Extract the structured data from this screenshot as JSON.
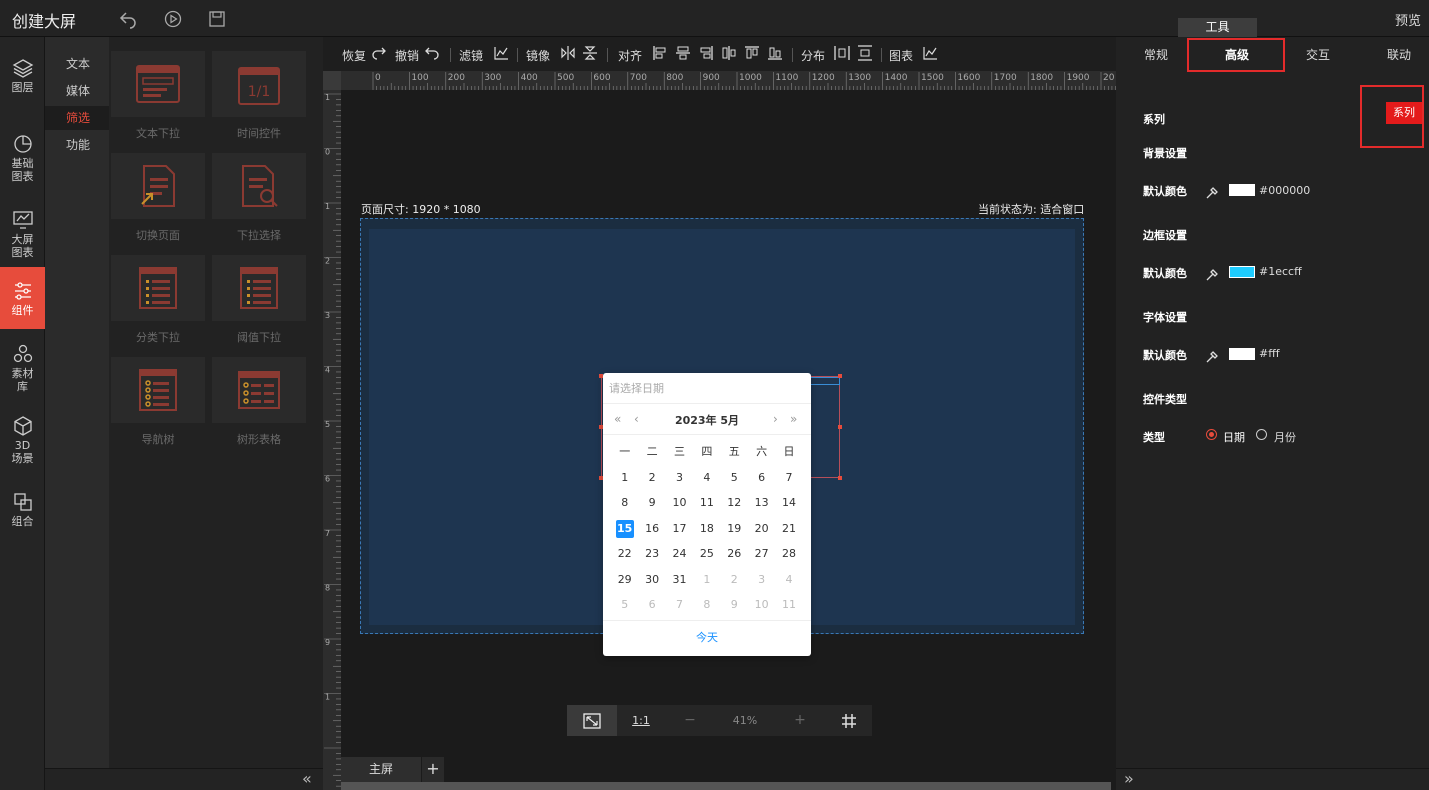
{
  "app": {
    "title": "创建大屏",
    "preview": "预览",
    "tooltip": "工具"
  },
  "leftnav": [
    {
      "label": "图层"
    },
    {
      "label": "基础\n图表"
    },
    {
      "label": "大屏\n图表"
    },
    {
      "label": "组件"
    },
    {
      "label": "素材\n库"
    },
    {
      "label": "3D\n场景"
    },
    {
      "label": "组合"
    }
  ],
  "subnav": [
    "文本",
    "媒体",
    "筛选",
    "功能"
  ],
  "widgets": [
    "文本下拉",
    "时间控件",
    "切换页面",
    "下拉选择",
    "分类下拉",
    "阈值下拉",
    "导航树",
    "树形表格"
  ],
  "toolbar": {
    "redo": "恢复",
    "undo": "撤销",
    "filter": "滤镜",
    "mirror": "镜像",
    "align": "对齐",
    "distribute": "分布",
    "chart": "图表"
  },
  "ruler": [
    "0",
    "100",
    "200",
    "300",
    "400",
    "500",
    "600",
    "700",
    "800",
    "900",
    "1000",
    "1100",
    "1200",
    "1300",
    "1400",
    "1500",
    "1600",
    "1700",
    "1800",
    "1900",
    "20"
  ],
  "ruler_v": [
    "1",
    "0",
    "1",
    "2",
    "3",
    "4",
    "5",
    "6",
    "7",
    "8",
    "9",
    "1"
  ],
  "canvas": {
    "page_size": "页面尺寸: 1920 * 1080",
    "state": "当前状态为: 适合窗口"
  },
  "datepicker": {
    "placeholder": "请选择日期",
    "month": "2023年 5月",
    "weekdays": [
      "一",
      "二",
      "三",
      "四",
      "五",
      "六",
      "日"
    ],
    "weeks": [
      [
        "1",
        "2",
        "3",
        "4",
        "5",
        "6",
        "7"
      ],
      [
        "8",
        "9",
        "10",
        "11",
        "12",
        "13",
        "14"
      ],
      [
        "15",
        "16",
        "17",
        "18",
        "19",
        "20",
        "21"
      ],
      [
        "22",
        "23",
        "24",
        "25",
        "26",
        "27",
        "28"
      ],
      [
        "29",
        "30",
        "31",
        "1",
        "2",
        "3",
        "4"
      ],
      [
        "5",
        "6",
        "7",
        "8",
        "9",
        "10",
        "11"
      ]
    ],
    "today": "15",
    "today_label": "今天"
  },
  "zoom": {
    "fit": "",
    "one_to_one": "1:1",
    "minus": "−",
    "level": "41%",
    "plus": "+"
  },
  "tabs": {
    "main": "主屏",
    "add": "+"
  },
  "rightpanel": {
    "tabs": [
      "常规",
      "高级",
      "交互",
      "联动"
    ],
    "series": "系列",
    "series_tag": "系列",
    "bg_section": "背景设置",
    "bg_label": "默认颜色",
    "bg_value": "#000000",
    "border_section": "边框设置",
    "border_label": "默认颜色",
    "border_value": "#1eccff",
    "font_section": "字体设置",
    "font_label": "默认颜色",
    "font_value": "#fff",
    "control_section": "控件类型",
    "type_label": "类型",
    "type_date": "日期",
    "type_month": "月份"
  },
  "colors": {
    "accent": "#e74c3c",
    "border_swatch": "#1eccff",
    "white_swatch": "#ffffff"
  }
}
